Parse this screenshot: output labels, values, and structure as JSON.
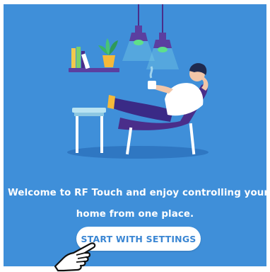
{
  "onboarding": {
    "welcome_line_1": "Welcome to RF Touch and enjoy controlling your",
    "welcome_line_2": "home from one place.",
    "start_button_label": "START WITH SETTINGS"
  },
  "colors": {
    "background": "#3f8fd9",
    "button_background": "#ffffff",
    "button_text": "#3a86d3"
  },
  "icons": {
    "pointer": "hand-pointer-icon"
  }
}
